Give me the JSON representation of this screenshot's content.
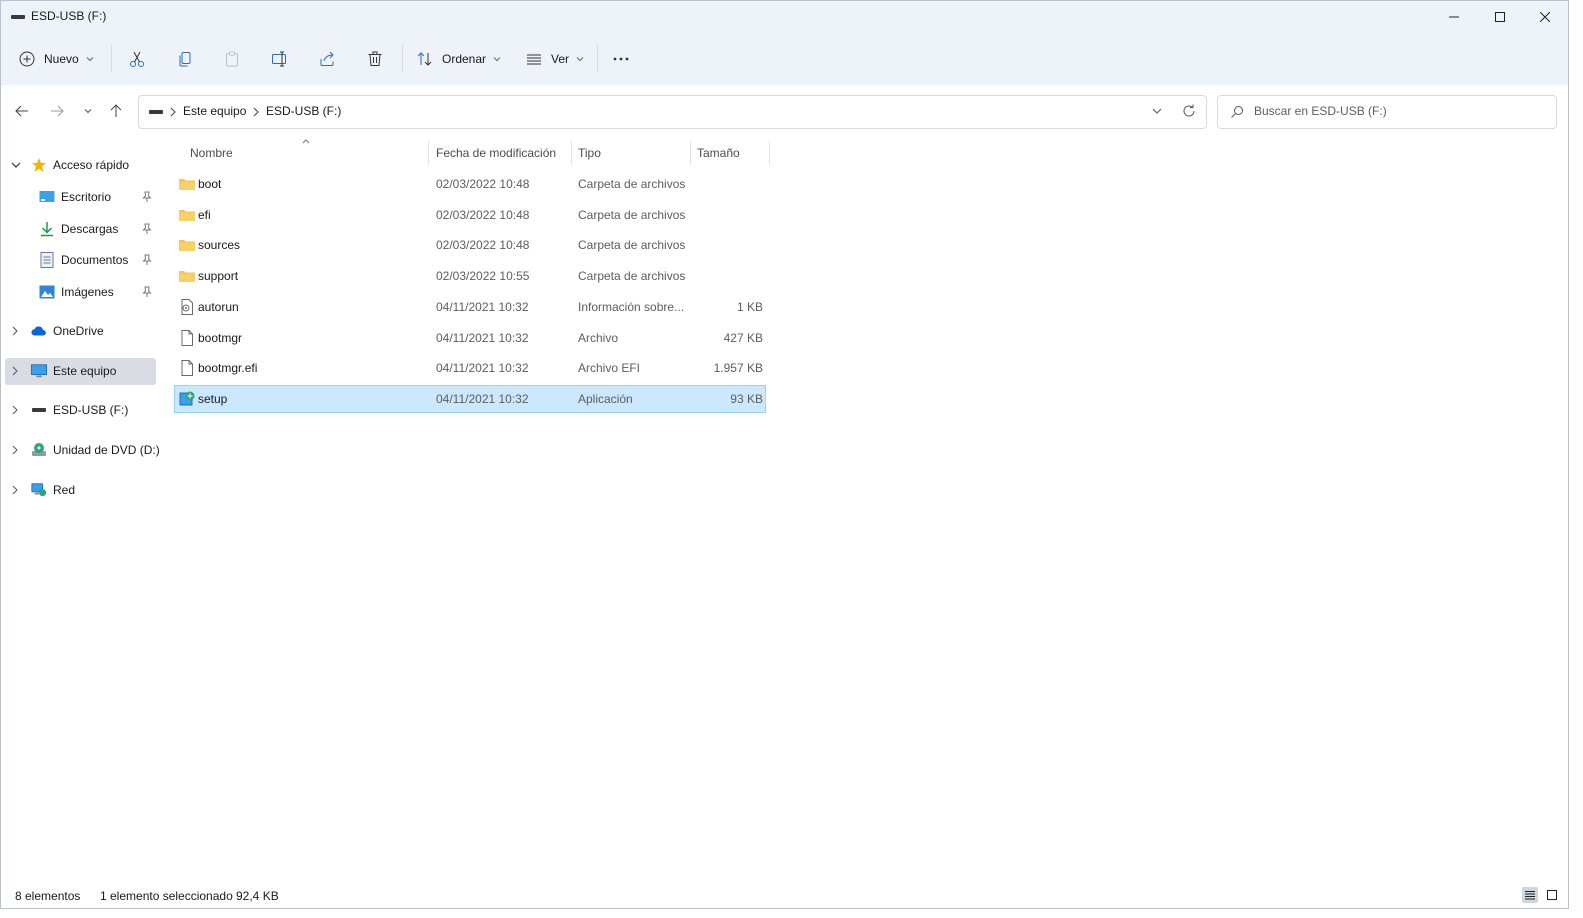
{
  "window": {
    "title": "ESD-USB (F:)"
  },
  "toolbar": {
    "new_label": "Nuevo",
    "sort_label": "Ordenar",
    "view_label": "Ver"
  },
  "address": {
    "crumbs": [
      "Este equipo",
      "ESD-USB (F:)"
    ]
  },
  "search": {
    "placeholder": "Buscar en ESD-USB (F:)"
  },
  "sidebar": {
    "quick_access": "Acceso rápido",
    "pinned": [
      {
        "label": "Escritorio",
        "icon": "desktop-icon"
      },
      {
        "label": "Descargas",
        "icon": "download-icon"
      },
      {
        "label": "Documentos",
        "icon": "documents-icon"
      },
      {
        "label": "Imágenes",
        "icon": "pictures-icon"
      }
    ],
    "onedrive": "OneDrive",
    "this_pc": "Este equipo",
    "usb": "ESD-USB (F:)",
    "dvd": "Unidad de DVD (D:)",
    "network": "Red"
  },
  "columns": {
    "name": "Nombre",
    "date": "Fecha de modificación",
    "type": "Tipo",
    "size": "Tamaño"
  },
  "files": [
    {
      "name": "boot",
      "date": "02/03/2022 10:48",
      "type": "Carpeta de archivos",
      "size": "",
      "icon": "folder-icon",
      "selected": false
    },
    {
      "name": "efi",
      "date": "02/03/2022 10:48",
      "type": "Carpeta de archivos",
      "size": "",
      "icon": "folder-icon",
      "selected": false
    },
    {
      "name": "sources",
      "date": "02/03/2022 10:48",
      "type": "Carpeta de archivos",
      "size": "",
      "icon": "folder-icon",
      "selected": false
    },
    {
      "name": "support",
      "date": "02/03/2022 10:55",
      "type": "Carpeta de archivos",
      "size": "",
      "icon": "folder-icon",
      "selected": false
    },
    {
      "name": "autorun",
      "date": "04/11/2021 10:32",
      "type": "Información sobre...",
      "size": "1 KB",
      "icon": "settings-file-icon",
      "selected": false
    },
    {
      "name": "bootmgr",
      "date": "04/11/2021 10:32",
      "type": "Archivo",
      "size": "427 KB",
      "icon": "file-icon",
      "selected": false
    },
    {
      "name": "bootmgr.efi",
      "date": "04/11/2021 10:32",
      "type": "Archivo EFI",
      "size": "1.957 KB",
      "icon": "file-icon",
      "selected": false
    },
    {
      "name": "setup",
      "date": "04/11/2021 10:32",
      "type": "Aplicación",
      "size": "93 KB",
      "icon": "setup-app-icon",
      "selected": true
    }
  ],
  "status": {
    "count": "8 elementos",
    "selection": "1 elemento seleccionado",
    "selection_size": "92,4 KB"
  },
  "colors": {
    "chrome_bg": "#eef2f9",
    "selection_bg": "#cce8ff",
    "selection_border": "#99d1ff",
    "folder": "#f3c44f",
    "accent": "#0067c0"
  }
}
